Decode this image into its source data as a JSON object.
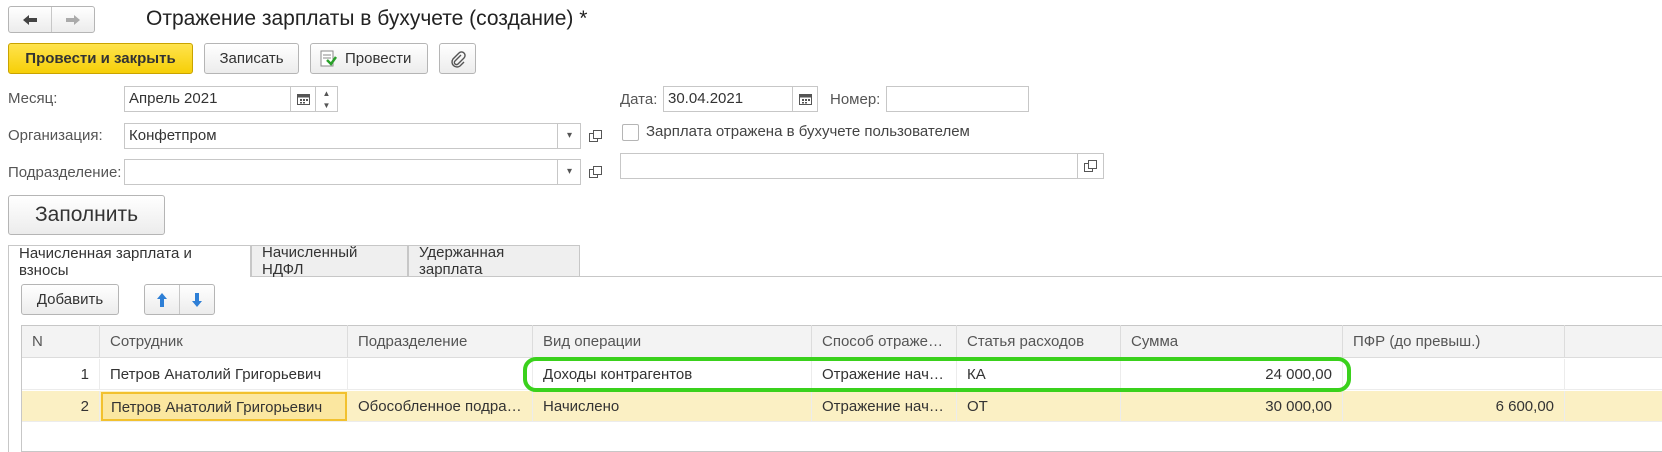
{
  "window": {
    "title": "Отражение зарплаты в бухучете (создание) *"
  },
  "toolbar": {
    "post_and_close": "Провести и закрыть",
    "save": "Записать",
    "post": "Провести"
  },
  "form": {
    "month_label": "Месяц:",
    "month_value": "Апрель 2021",
    "org_label": "Организация:",
    "org_value": "Конфетпром",
    "dept_label": "Подразделение:",
    "dept_value": "",
    "date_label": "Дата:",
    "date_value": "30.04.2021",
    "number_label": "Номер:",
    "number_value": "",
    "user_checkbox_label": "Зарплата отражена в бухучете пользователем",
    "user_checkbox_checked": false,
    "comment_value": ""
  },
  "fill_button": "Заполнить",
  "tabs": [
    {
      "label": "Начисленная зарплата и взносы",
      "active": true
    },
    {
      "label": "Начисленный НДФЛ",
      "active": false
    },
    {
      "label": "Удержанная зарплата",
      "active": false
    }
  ],
  "table_toolbar": {
    "add": "Добавить"
  },
  "table": {
    "columns": [
      "N",
      "Сотрудник",
      "Подразделение",
      "Вид операции",
      "Способ отраже…",
      "Статья расходов",
      "Сумма",
      "ПФР (до превыш.)"
    ],
    "rows": [
      {
        "n": "1",
        "employee": "Петров Анатолий Григорьевич",
        "dept": "",
        "operation": "Доходы контрагентов",
        "method": "Отражение нач…",
        "expense": "КА",
        "sum": "24 000,00",
        "pfr": ""
      },
      {
        "n": "2",
        "employee": "Петров Анатолий Григорьевич",
        "dept": "Обособленное подра…",
        "operation": "Начислено",
        "method": "Отражение нач…",
        "expense": "ОТ",
        "sum": "30 000,00",
        "pfr": "6 600,00"
      }
    ]
  },
  "colors": {
    "accent_yellow": "#f6cf07",
    "row_selected": "#fbf0c4",
    "highlight_outline": "#3ad11c"
  }
}
